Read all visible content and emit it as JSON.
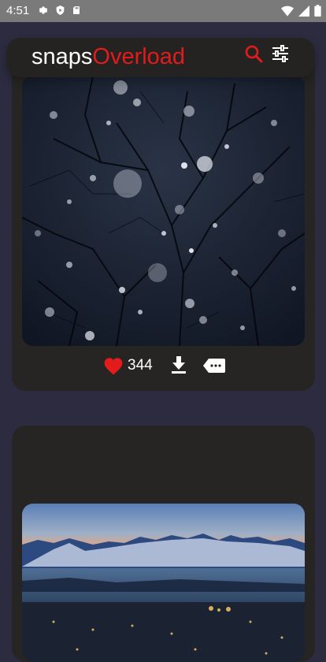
{
  "status_bar": {
    "time": "4:51",
    "left_icons": [
      "gear-icon",
      "shield-play-icon",
      "sd-card-icon"
    ],
    "right_icons": [
      "wifi-icon",
      "signal-icon",
      "battery-icon"
    ]
  },
  "app_bar": {
    "brand_part1": "snaps",
    "brand_part2": "Overload",
    "brand_accent_color": "#e31b1b",
    "actions": [
      "search-icon",
      "filter-sliders-icon"
    ]
  },
  "feed": [
    {
      "image": "snowy night with bare tree branches",
      "likes": "344",
      "actions": [
        "heart-icon",
        "download-icon",
        "tag-icon"
      ]
    },
    {
      "image": "mountains over fjord with city lights at dusk"
    }
  ]
}
